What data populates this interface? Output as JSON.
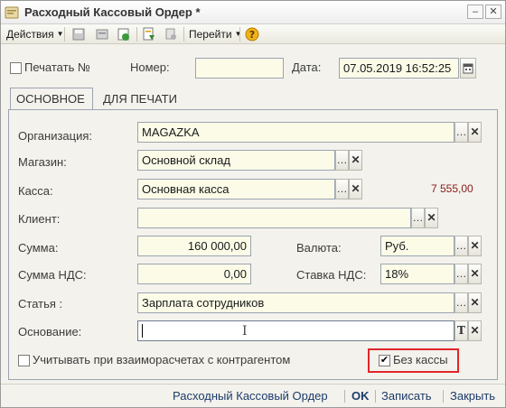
{
  "window": {
    "title": "Расходный Кассовый Ордер *"
  },
  "toolbar": {
    "actions_label": "Действия",
    "goto_label": "Перейти"
  },
  "header": {
    "print_number_label": "Печатать №",
    "number_label": "Номер:",
    "number_value": "",
    "date_label": "Дата:",
    "date_value": "07.05.2019 16:52:25"
  },
  "tabs": [
    {
      "label": "ОСНОВНОЕ"
    },
    {
      "label": "ДЛЯ ПЕЧАТИ"
    }
  ],
  "form": {
    "organization": {
      "label": "Организация:",
      "value": "MAGAZKA"
    },
    "store": {
      "label": "Магазин:",
      "value": "Основной склад"
    },
    "cashbox": {
      "label": "Касса:",
      "value": "Основная касса",
      "balance": "7 555,00"
    },
    "client": {
      "label": "Клиент:",
      "value": ""
    },
    "amount": {
      "label": "Сумма:",
      "value": "160 000,00"
    },
    "currency": {
      "label": "Валюта:",
      "value": "Руб."
    },
    "vat_amount": {
      "label": "Сумма НДС:",
      "value": "0,00"
    },
    "vat_rate": {
      "label": "Ставка НДС:",
      "value": "18%"
    },
    "article": {
      "label": "Статья :",
      "value": "Зарплата сотрудников"
    },
    "basis": {
      "label": "Основание:",
      "value": ""
    },
    "mutual_settlements": {
      "label": "Учитывать при взаиморасчетах с контрагентом",
      "checked": false
    },
    "no_cashbox": {
      "label": "Без кассы",
      "checked": true
    }
  },
  "footer": {
    "print_form_label": "Расходный Кассовый Ордер",
    "ok_label": "OK",
    "save_label": "Записать",
    "close_label": "Закрыть"
  },
  "colors": {
    "highlight_box": "#e0262a",
    "balance": "#8b1a1a",
    "link": "#1d3b6b"
  }
}
